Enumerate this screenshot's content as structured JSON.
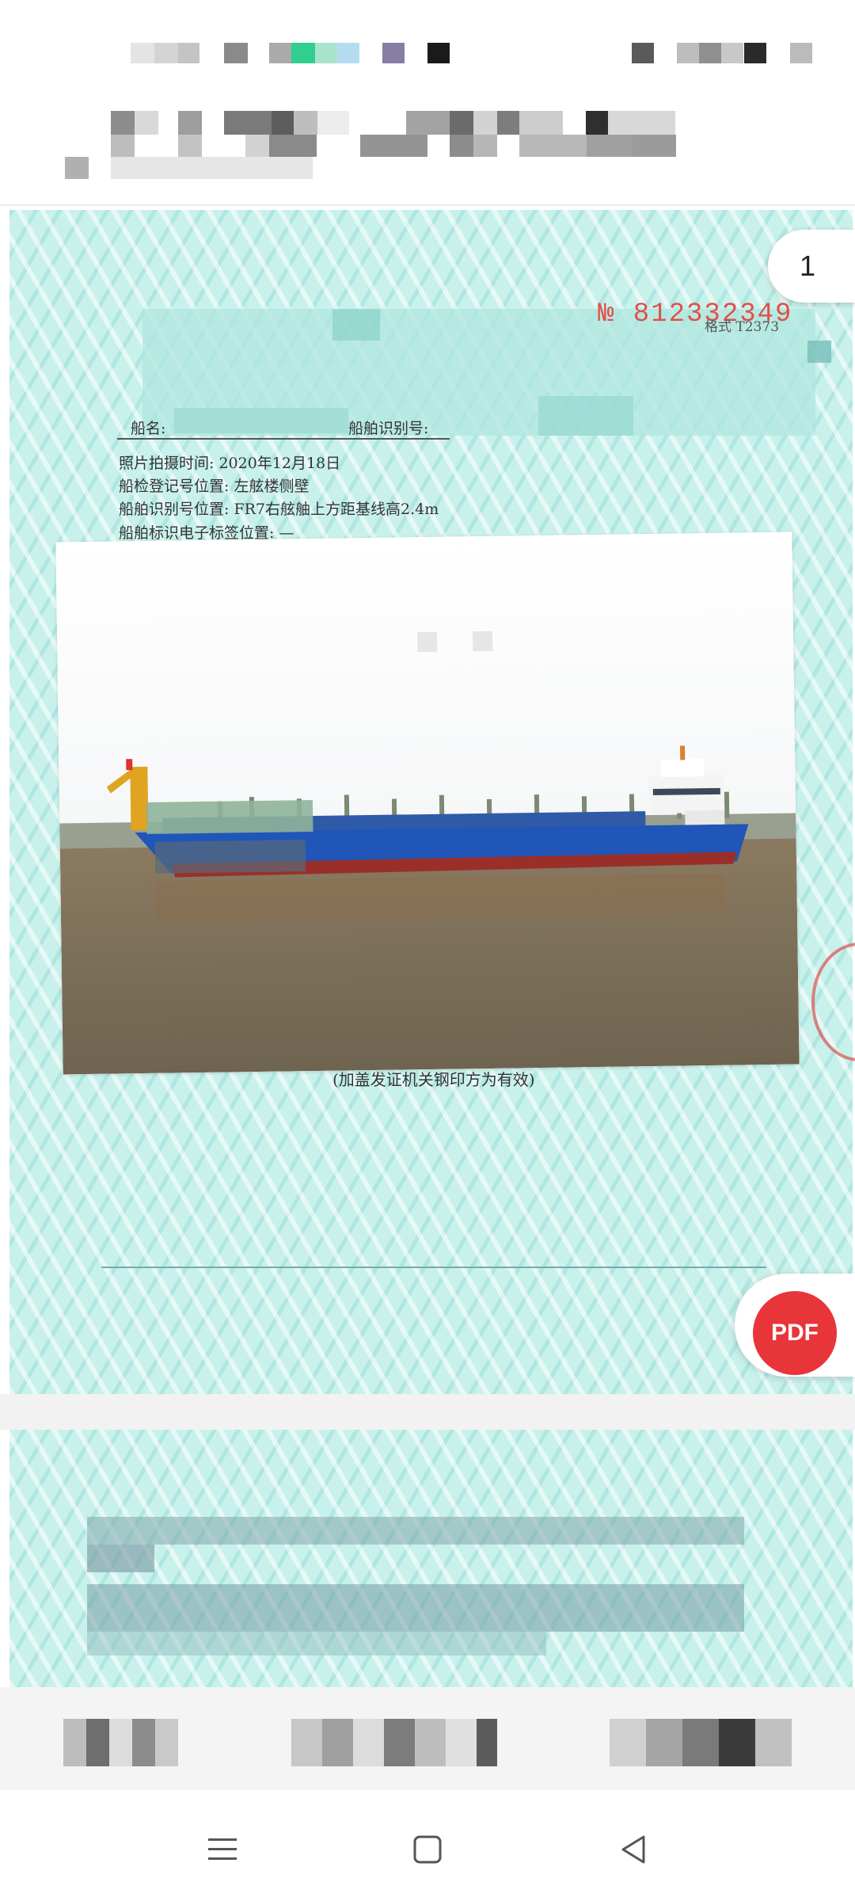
{
  "viewer": {
    "page_number": "1",
    "pdf_label": "PDF"
  },
  "document": {
    "serial": "№ 812332349",
    "format_code": "格式 T2373",
    "ship_name_label": "船名:",
    "ship_id_label": "船舶识别号:",
    "photo_time": "照片拍摄时间: 2020年12月18日",
    "registration_position": "船检登记号位置: 左舷楼侧壁",
    "id_position": "船舶识别号位置: FR7右舷舳上方距基线高2.4m",
    "tag_position": "船舶标识电子标签位置: —",
    "caption": "(加盖发证机关钢印方为有效)"
  },
  "nav": {
    "menu_icon": "menu-icon",
    "home_icon": "home-icon",
    "back_icon": "back-icon"
  },
  "colors": {
    "pdf_button": "#e8353a",
    "serial_red": "#e0504a",
    "page_bg": "#c9f1ec",
    "hull_blue": "#1f56b8",
    "hull_red": "#9a2f2a"
  }
}
